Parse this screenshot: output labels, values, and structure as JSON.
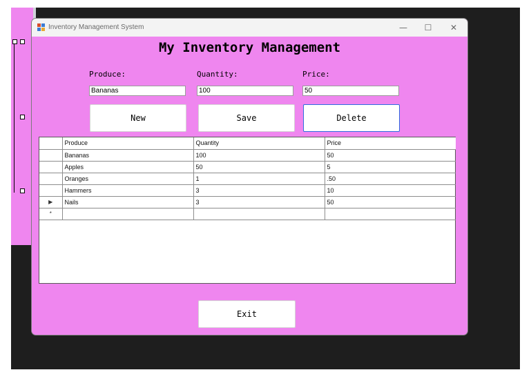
{
  "colors": {
    "form_background": "#ef86ef",
    "desktop_background": "#1e1e1e",
    "focus_border": "#2d6cdf"
  },
  "window": {
    "title": "Inventory Management System",
    "icon": "winforms-app-icon",
    "minimize_glyph": "—",
    "maximize_glyph": "☐",
    "close_glyph": "✕"
  },
  "form": {
    "heading": "My Inventory Management",
    "labels": {
      "produce": "Produce:",
      "quantity": "Quantity:",
      "price": "Price:"
    },
    "inputs": {
      "produce": "Bananas",
      "quantity": "100",
      "price": "50"
    },
    "buttons": {
      "new": "New",
      "save": "Save",
      "delete": "Delete",
      "exit": "Exit"
    }
  },
  "grid": {
    "columns": [
      "Produce",
      "Quantity",
      "Price"
    ],
    "rows": [
      {
        "produce": "Bananas",
        "quantity": "100",
        "price": "50",
        "marker": ""
      },
      {
        "produce": "Apples",
        "quantity": "50",
        "price": "5",
        "marker": ""
      },
      {
        "produce": "Oranges",
        "quantity": "1",
        "price": ".50",
        "marker": ""
      },
      {
        "produce": "Hammers",
        "quantity": "3",
        "price": "10",
        "marker": ""
      },
      {
        "produce": "Nails",
        "quantity": "3",
        "price": "50",
        "marker": "▶"
      }
    ],
    "new_row_marker": "*"
  }
}
